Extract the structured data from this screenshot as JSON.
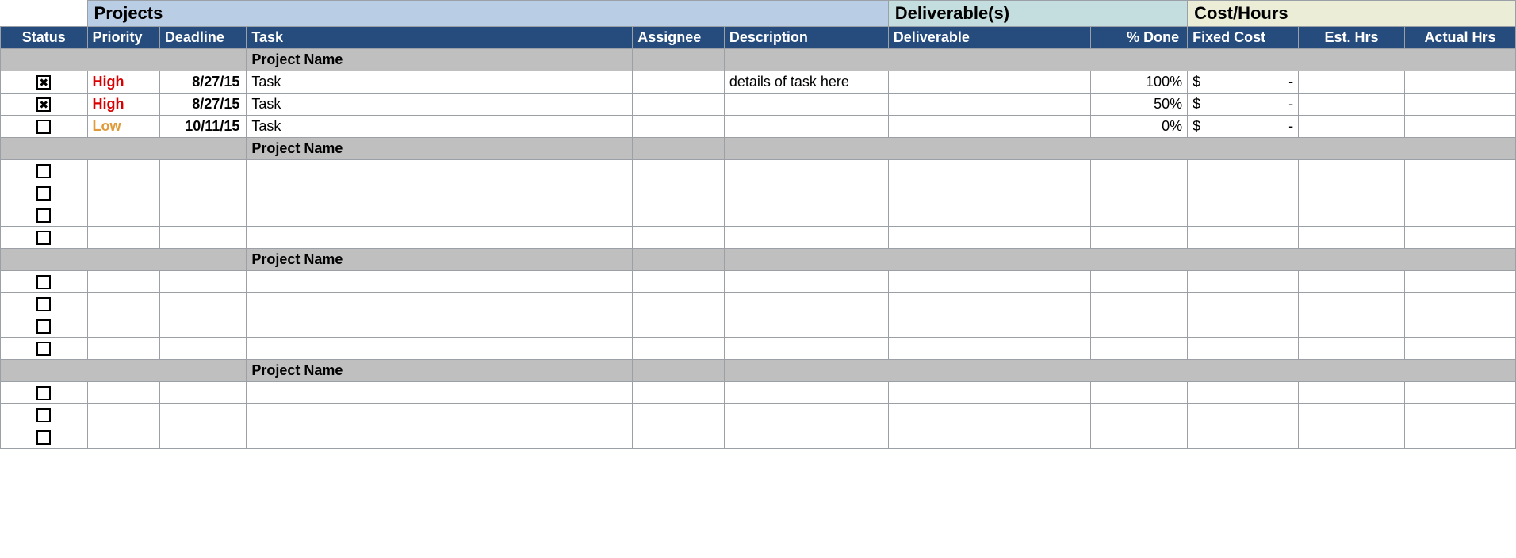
{
  "sections": {
    "projects": "Projects",
    "deliverables": "Deliverable(s)",
    "cost": "Cost/Hours"
  },
  "headers": {
    "status": "Status",
    "priority": "Priority",
    "deadline": "Deadline",
    "task": "Task",
    "assignee": "Assignee",
    "description": "Description",
    "deliverable": "Deliverable",
    "pctDone": "% Done",
    "fixedCost": "Fixed Cost",
    "estHrs": "Est. Hrs",
    "actualHrs": "Actual Hrs"
  },
  "groups": [
    {
      "name": "Project Name",
      "rows": [
        {
          "checked": true,
          "priority": "High",
          "priorityClass": "prio-high",
          "deadline": "8/27/15",
          "task": "Task",
          "assignee": "",
          "description": "details of task here",
          "deliverable": "",
          "pctDone": "100%",
          "fixedCostSym": "$",
          "fixedCostVal": "-",
          "estHrs": "",
          "actualHrs": ""
        },
        {
          "checked": true,
          "priority": "High",
          "priorityClass": "prio-high",
          "deadline": "8/27/15",
          "task": "Task",
          "assignee": "",
          "description": "",
          "deliverable": "",
          "pctDone": "50%",
          "fixedCostSym": "$",
          "fixedCostVal": "-",
          "estHrs": "",
          "actualHrs": ""
        },
        {
          "checked": false,
          "priority": "Low",
          "priorityClass": "prio-low",
          "deadline": "10/11/15",
          "task": "Task",
          "assignee": "",
          "description": "",
          "deliverable": "",
          "pctDone": "0%",
          "fixedCostSym": "$",
          "fixedCostVal": "-",
          "estHrs": "",
          "actualHrs": ""
        }
      ]
    },
    {
      "name": "Project Name",
      "rows": [
        {
          "checked": false,
          "priority": "",
          "priorityClass": "",
          "deadline": "",
          "task": "",
          "assignee": "",
          "description": "",
          "deliverable": "",
          "pctDone": "",
          "fixedCostSym": "",
          "fixedCostVal": "",
          "estHrs": "",
          "actualHrs": ""
        },
        {
          "checked": false,
          "priority": "",
          "priorityClass": "",
          "deadline": "",
          "task": "",
          "assignee": "",
          "description": "",
          "deliverable": "",
          "pctDone": "",
          "fixedCostSym": "",
          "fixedCostVal": "",
          "estHrs": "",
          "actualHrs": ""
        },
        {
          "checked": false,
          "priority": "",
          "priorityClass": "",
          "deadline": "",
          "task": "",
          "assignee": "",
          "description": "",
          "deliverable": "",
          "pctDone": "",
          "fixedCostSym": "",
          "fixedCostVal": "",
          "estHrs": "",
          "actualHrs": ""
        },
        {
          "checked": false,
          "priority": "",
          "priorityClass": "",
          "deadline": "",
          "task": "",
          "assignee": "",
          "description": "",
          "deliverable": "",
          "pctDone": "",
          "fixedCostSym": "",
          "fixedCostVal": "",
          "estHrs": "",
          "actualHrs": ""
        }
      ]
    },
    {
      "name": "Project Name",
      "rows": [
        {
          "checked": false,
          "priority": "",
          "priorityClass": "",
          "deadline": "",
          "task": "",
          "assignee": "",
          "description": "",
          "deliverable": "",
          "pctDone": "",
          "fixedCostSym": "",
          "fixedCostVal": "",
          "estHrs": "",
          "actualHrs": ""
        },
        {
          "checked": false,
          "priority": "",
          "priorityClass": "",
          "deadline": "",
          "task": "",
          "assignee": "",
          "description": "",
          "deliverable": "",
          "pctDone": "",
          "fixedCostSym": "",
          "fixedCostVal": "",
          "estHrs": "",
          "actualHrs": ""
        },
        {
          "checked": false,
          "priority": "",
          "priorityClass": "",
          "deadline": "",
          "task": "",
          "assignee": "",
          "description": "",
          "deliverable": "",
          "pctDone": "",
          "fixedCostSym": "",
          "fixedCostVal": "",
          "estHrs": "",
          "actualHrs": ""
        },
        {
          "checked": false,
          "priority": "",
          "priorityClass": "",
          "deadline": "",
          "task": "",
          "assignee": "",
          "description": "",
          "deliverable": "",
          "pctDone": "",
          "fixedCostSym": "",
          "fixedCostVal": "",
          "estHrs": "",
          "actualHrs": ""
        }
      ]
    },
    {
      "name": "Project Name",
      "rows": [
        {
          "checked": false,
          "priority": "",
          "priorityClass": "",
          "deadline": "",
          "task": "",
          "assignee": "",
          "description": "",
          "deliverable": "",
          "pctDone": "",
          "fixedCostSym": "",
          "fixedCostVal": "",
          "estHrs": "",
          "actualHrs": ""
        },
        {
          "checked": false,
          "priority": "",
          "priorityClass": "",
          "deadline": "",
          "task": "",
          "assignee": "",
          "description": "",
          "deliverable": "",
          "pctDone": "",
          "fixedCostSym": "",
          "fixedCostVal": "",
          "estHrs": "",
          "actualHrs": ""
        },
        {
          "checked": false,
          "priority": "",
          "priorityClass": "",
          "deadline": "",
          "task": "",
          "assignee": "",
          "description": "",
          "deliverable": "",
          "pctDone": "",
          "fixedCostSym": "",
          "fixedCostVal": "",
          "estHrs": "",
          "actualHrs": ""
        }
      ]
    }
  ]
}
